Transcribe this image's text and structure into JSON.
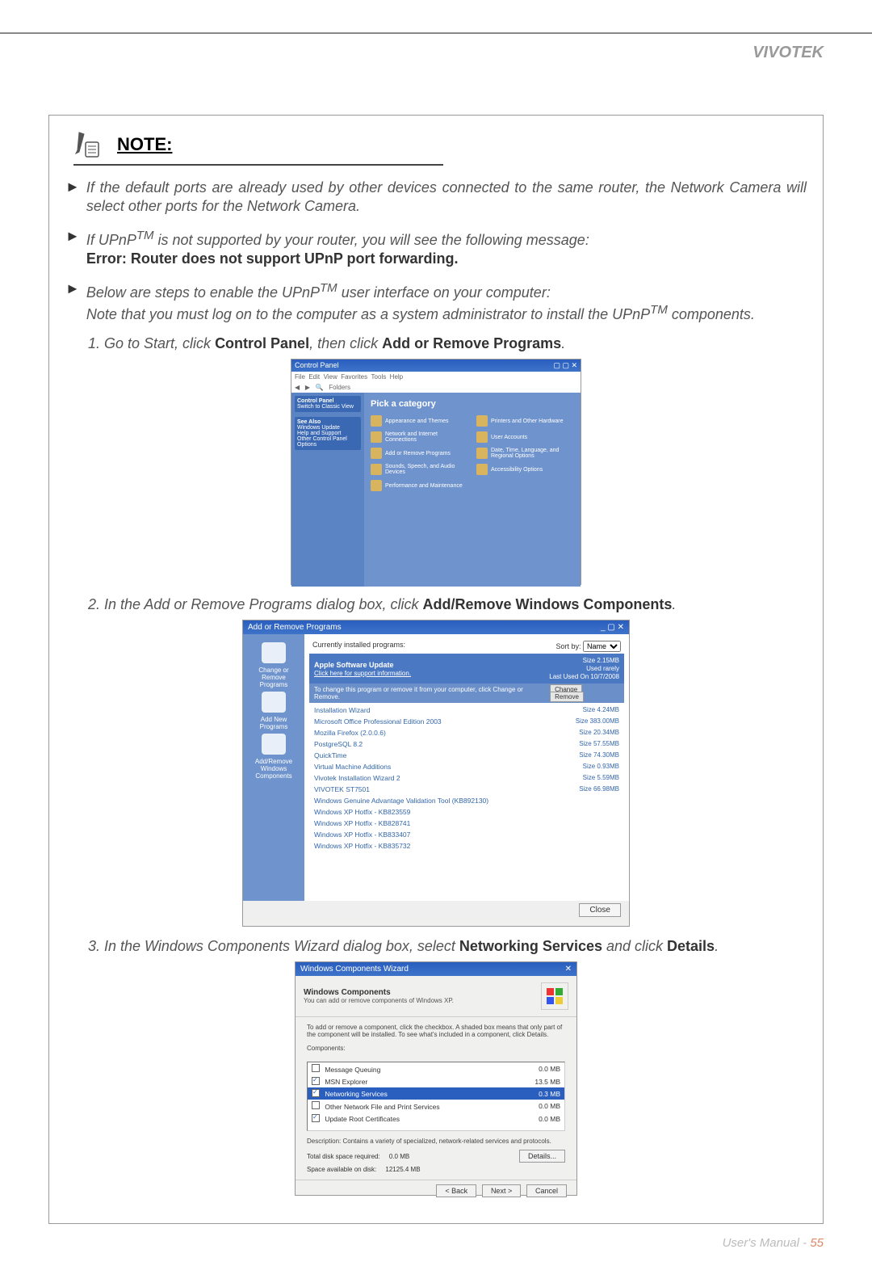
{
  "brand": "VIVOTEK",
  "note_title": "NOTE:",
  "bullet1": "If the default ports are already used by other devices connected to the same router, the Network Camera will select other ports for the Network Camera.",
  "bullet2a": "If UPnP",
  "bullet2b": " is not supported by your router, you will see the following message:",
  "bullet2_error": "Error: Router does not support UPnP port forwarding.",
  "bullet3a": "Below are steps to enable the UPnP",
  "bullet3b": " user interface on your computer:",
  "bullet3_note_a": "Note that you must log on to the computer as a system administrator to install the UPnP",
  "bullet3_note_b": " components.",
  "tm": "TM",
  "step1_pre": "1. Go to Start, click ",
  "step1_b1": "Control Panel",
  "step1_mid": ", then click ",
  "step1_b2": "Add or Remove Programs",
  "step1_post": ".",
  "step2_pre": "2. In the Add or Remove Programs dialog box, click ",
  "step2_b1": "Add/Remove Windows Components",
  "step2_post": ".",
  "step3_pre": "3. In the Windows Components Wizard dialog box, select ",
  "step3_b1": "Networking Services",
  "step3_mid": " and click ",
  "step3_b2": "Details",
  "step3_post": ".",
  "footer_label": "User's Manual - ",
  "footer_page": "55",
  "mock1": {
    "title": "Control Panel",
    "heading": "Pick a category",
    "side": [
      "Control Panel",
      "Switch to Classic View",
      "See Also",
      "Windows Update",
      "Help and Support",
      "Other Control Panel Options"
    ],
    "items": [
      "Appearance and Themes",
      "Printers and Other Hardware",
      "Network and Internet Connections",
      "User Accounts",
      "Add or Remove Programs",
      "Date, Time, Language, and Regional Options",
      "Sounds, Speech, and Audio Devices",
      "Accessibility Options",
      "Performance and Maintenance",
      ""
    ]
  },
  "mock2": {
    "title": "Add or Remove Programs",
    "sort_label": "Sort by:",
    "sort_value": "Name",
    "currently": "Currently installed programs:",
    "side": [
      "Change or Remove Programs",
      "Add New Programs",
      "Add/Remove Windows Components"
    ],
    "highlight_name": "Apple Software Update",
    "highlight_link": "Click here for support information.",
    "highlight_size": "Size     2.15MB",
    "highlight_used": "Used     rarely",
    "highlight_lastused": "Last Used On  10/7/2008",
    "change_row": "To change this program or remove it from your computer, click Change or Remove.",
    "btn_change": "Change",
    "btn_remove": "Remove",
    "items": [
      {
        "n": "Installation Wizard",
        "s": "Size    4.24MB"
      },
      {
        "n": "Microsoft Office Professional Edition 2003",
        "s": "Size  383.00MB"
      },
      {
        "n": "Mozilla Firefox (2.0.0.6)",
        "s": "Size   20.34MB"
      },
      {
        "n": "PostgreSQL 8.2",
        "s": "Size   57.55MB"
      },
      {
        "n": "QuickTime",
        "s": "Size   74.30MB"
      },
      {
        "n": "Virtual Machine Additions",
        "s": "Size    0.93MB"
      },
      {
        "n": "Vivotek Installation Wizard 2",
        "s": "Size    5.59MB"
      },
      {
        "n": "VIVOTEK ST7501",
        "s": "Size   66.98MB"
      },
      {
        "n": "Windows Genuine Advantage Validation Tool (KB892130)",
        "s": ""
      },
      {
        "n": "Windows XP Hotfix - KB823559",
        "s": ""
      },
      {
        "n": "Windows XP Hotfix - KB828741",
        "s": ""
      },
      {
        "n": "Windows XP Hotfix - KB833407",
        "s": ""
      },
      {
        "n": "Windows XP Hotfix - KB835732",
        "s": ""
      }
    ],
    "btn_close": "Close"
  },
  "mock3": {
    "title": "Windows Components Wizard",
    "heading": "Windows Components",
    "sub": "You can add or remove components of Windows XP.",
    "instr": "To add or remove a component, click the checkbox. A shaded box means that only part of the component will be installed. To see what's included in a component, click Details.",
    "comp_label": "Components:",
    "items": [
      {
        "n": "Message Queuing",
        "s": "0.0 MB",
        "chk": false,
        "sel": false
      },
      {
        "n": "MSN Explorer",
        "s": "13.5 MB",
        "chk": true,
        "sel": false
      },
      {
        "n": "Networking Services",
        "s": "0.3 MB",
        "chk": true,
        "sel": true
      },
      {
        "n": "Other Network File and Print Services",
        "s": "0.0 MB",
        "chk": false,
        "sel": false
      },
      {
        "n": "Update Root Certificates",
        "s": "0.0 MB",
        "chk": true,
        "sel": false
      }
    ],
    "desc": "Description:  Contains a variety of specialized, network-related services and protocols.",
    "space1_l": "Total disk space required:",
    "space1_v": "0.0 MB",
    "space2_l": "Space available on disk:",
    "space2_v": "12125.4 MB",
    "btn_details": "Details...",
    "btn_back": "< Back",
    "btn_next": "Next >",
    "btn_cancel": "Cancel"
  }
}
